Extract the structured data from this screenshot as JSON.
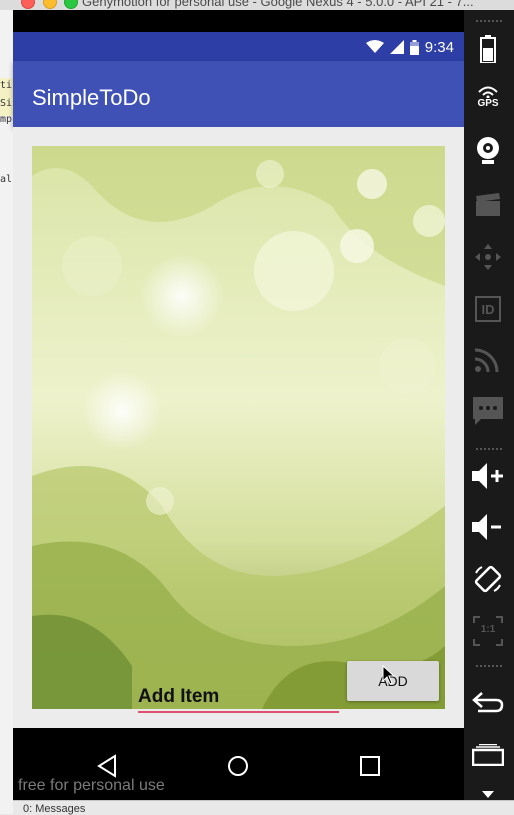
{
  "window": {
    "title": "Genymotion for personal use - Google Nexus 4 - 5.0.0 - API 21 - 7..."
  },
  "ide": {
    "lines": [
      "tir",
      "Si",
      "mp",
      "al"
    ]
  },
  "statusbar": {
    "time": "9:34",
    "icons": [
      "wifi-icon",
      "cellular-icon",
      "battery-icon"
    ]
  },
  "app": {
    "title": "SimpleToDo",
    "input": {
      "placeholder": "Add Item",
      "value": ""
    },
    "add_button": "ADD"
  },
  "navbar": {
    "buttons": [
      "back-icon",
      "home-icon",
      "recents-icon"
    ]
  },
  "watermark": "free for personal use",
  "genymotion_toolbar": {
    "gps_label": "GPS",
    "id_label": "ID",
    "pixel_label": "1:1",
    "icons": [
      "battery-icon",
      "gps-icon",
      "webcam-icon",
      "media-icon",
      "dpad-icon",
      "identifiers-icon",
      "network-icon",
      "sms-icon",
      "volume-up-icon",
      "volume-down-icon",
      "rotate-icon",
      "pixel-perfect-icon",
      "back-icon",
      "recent-apps-icon",
      "menu-icon"
    ]
  },
  "ide_bottom": {
    "label": "0: Messages"
  }
}
